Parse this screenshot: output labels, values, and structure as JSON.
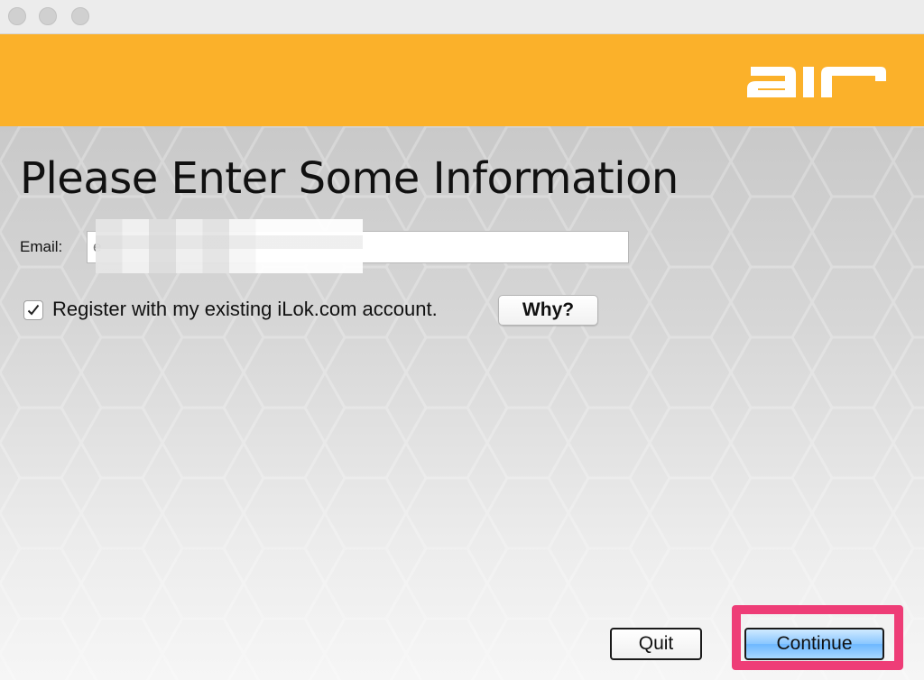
{
  "window": {
    "controls": [
      "close-button",
      "minimize-button",
      "zoom-button"
    ]
  },
  "header": {
    "logo_text": "air",
    "background_color": "#fbb12a"
  },
  "main": {
    "title": "Please Enter Some Information",
    "email": {
      "label": "Email:",
      "value": "e"
    },
    "register": {
      "checked": true,
      "label": "Register with my existing iLok.com account.",
      "why_label": "Why?"
    }
  },
  "footer": {
    "quit_label": "Quit",
    "continue_label": "Continue",
    "highlight_color": "#ee3d77"
  }
}
